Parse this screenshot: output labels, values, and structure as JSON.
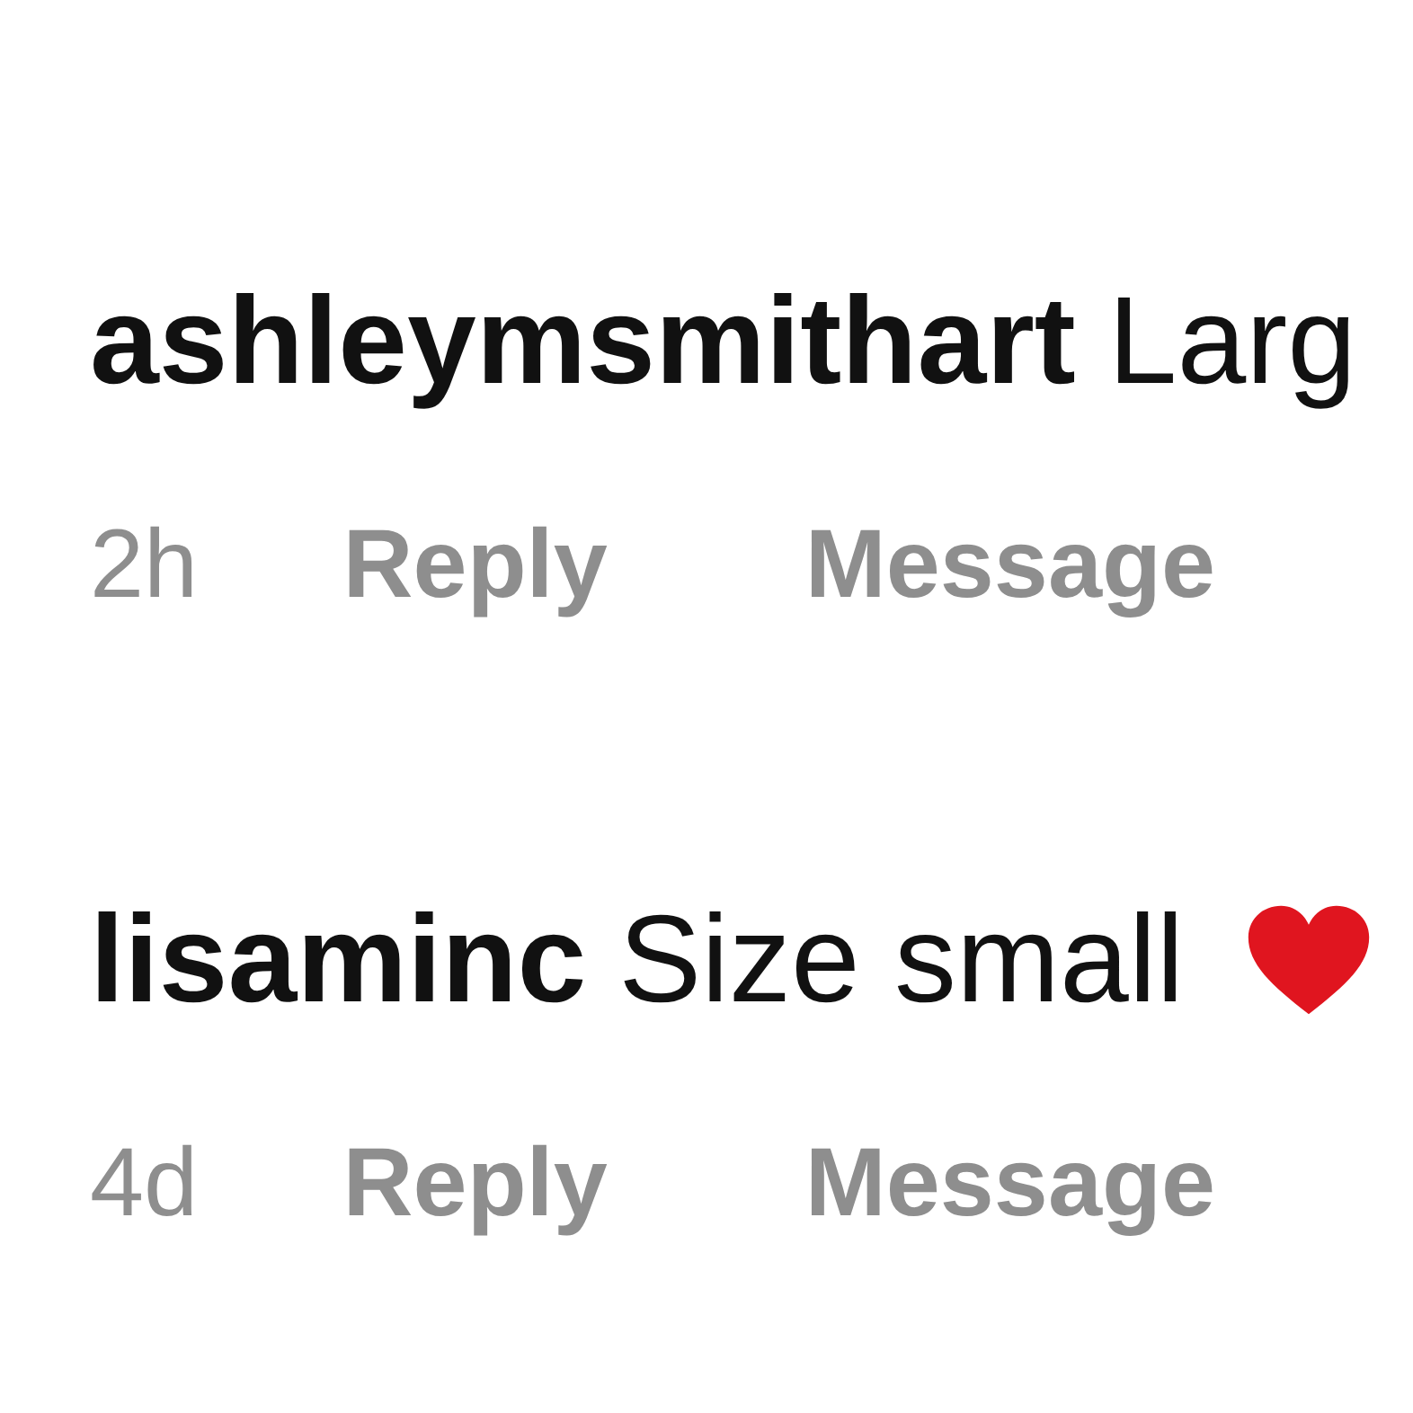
{
  "comments": [
    {
      "username": "ashleymsmithart",
      "text": "Larg",
      "heart": false,
      "time": "2h",
      "actions": [
        "Reply",
        "Message"
      ]
    },
    {
      "username": "lisaminc",
      "text": "Size small",
      "heart": true,
      "time": "4d",
      "actions": [
        "Reply",
        "Message"
      ]
    }
  ]
}
